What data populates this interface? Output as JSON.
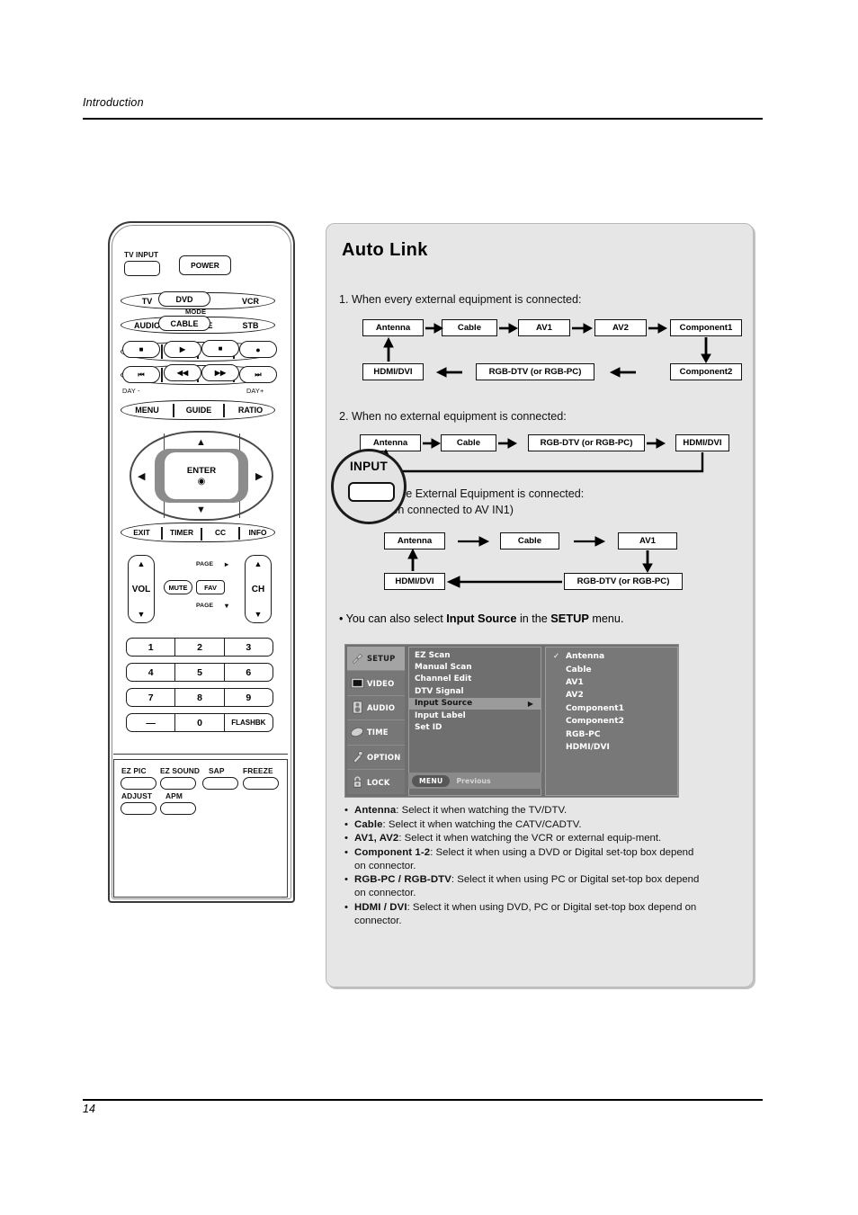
{
  "page": {
    "header": "Introduction",
    "number": "14"
  },
  "remote": {
    "labels": {
      "tv_input": "TV INPUT",
      "power": "POWER",
      "mode": "MODE",
      "day_minus": "DAY -",
      "day_plus": "DAY+",
      "page_up": "PAGE",
      "page_down": "PAGE",
      "vol": "VOL",
      "ch": "CH",
      "enter": "ENTER"
    },
    "mode_row1": [
      "TV",
      "DVD",
      "VCR"
    ],
    "mode_row2": [
      "AUDIO",
      "CABLE",
      "STB"
    ],
    "transport_row1": [
      "stop-icon",
      "play-icon",
      "record-stop-icon",
      "record-icon"
    ],
    "transport_row2": [
      "skip-back-icon",
      "rewind-icon",
      "fast-forward-icon",
      "skip-forward-icon"
    ],
    "menu_row": [
      "MENU",
      "GUIDE",
      "RATIO"
    ],
    "exit_row": [
      "EXIT",
      "TIMER",
      "CC",
      "INFO"
    ],
    "mute": "MUTE",
    "fav": "FAV",
    "keypad": [
      [
        "1",
        "2",
        "3"
      ],
      [
        "4",
        "5",
        "6"
      ],
      [
        "7",
        "8",
        "9"
      ],
      [
        "—",
        "0",
        "FLASHBK"
      ]
    ],
    "bottom_row1": [
      "EZ PIC",
      "EZ SOUND",
      "SAP",
      "FREEZE"
    ],
    "bottom_row2": [
      "ADJUST",
      "APM"
    ],
    "magnifier": {
      "label": "INPUT"
    }
  },
  "panel": {
    "title": "Auto Link",
    "step1": {
      "text": "1. When every external equipment is connected:",
      "top_row": [
        "Antenna",
        "Cable",
        "AV1",
        "AV2",
        "Component1"
      ],
      "bottom_row": [
        "HDMI/DVI",
        "RGB-DTV (or RGB-PC)",
        "Component2"
      ]
    },
    "step2": {
      "text": "2. When no external equipment is connected:",
      "row": [
        "Antenna",
        "Cable",
        "RGB-DTV (or RGB-PC)",
        "HDMI/DVI"
      ]
    },
    "step3": {
      "text_line1": "3. When some External Equipment is connected:",
      "text_line2": "(ex: When connected to AV IN1)",
      "top_row": [
        "Antenna",
        "Cable",
        "AV1"
      ],
      "bottom_row": [
        "HDMI/DVI",
        "RGB-DTV (or RGB-PC)"
      ]
    },
    "note": {
      "prefix": "• You can also select ",
      "bold1": "Input Source",
      "middle": " in the ",
      "bold2": "SETUP",
      "suffix": " menu."
    }
  },
  "osd": {
    "categories": [
      {
        "label": "SETUP",
        "icon": "setup-icon",
        "selected": true
      },
      {
        "label": "VIDEO",
        "icon": "video-icon",
        "selected": false
      },
      {
        "label": "AUDIO",
        "icon": "audio-icon",
        "selected": false
      },
      {
        "label": "TIME",
        "icon": "time-icon",
        "selected": false
      },
      {
        "label": "OPTION",
        "icon": "option-icon",
        "selected": false
      },
      {
        "label": "LOCK",
        "icon": "lock-icon",
        "selected": false
      }
    ],
    "items": [
      {
        "label": "EZ Scan",
        "active": false,
        "chevron": ""
      },
      {
        "label": "Manual Scan",
        "active": false,
        "chevron": ""
      },
      {
        "label": "Channel Edit",
        "active": false,
        "chevron": ""
      },
      {
        "label": "DTV Signal",
        "active": false,
        "chevron": ""
      },
      {
        "label": "Input Source",
        "active": true,
        "chevron": "▶"
      },
      {
        "label": "Input Label",
        "active": false,
        "chevron": ""
      },
      {
        "label": "Set ID",
        "active": false,
        "chevron": ""
      }
    ],
    "menubar": {
      "button": "MENU",
      "text": "Previous"
    },
    "sources": [
      {
        "label": "Antenna",
        "checked": "✓"
      },
      {
        "label": "Cable",
        "checked": ""
      },
      {
        "label": "AV1",
        "checked": ""
      },
      {
        "label": "AV2",
        "checked": ""
      },
      {
        "label": "Component1",
        "checked": ""
      },
      {
        "label": "Component2",
        "checked": ""
      },
      {
        "label": "RGB-PC",
        "checked": ""
      },
      {
        "label": "HDMI/DVI",
        "checked": ""
      }
    ]
  },
  "bullets": [
    {
      "term": "Antenna",
      "rest": ": Select it when watching the TV/DTV."
    },
    {
      "term": "Cable",
      "rest": ": Select it when watching the CATV/CADTV."
    },
    {
      "term": "AV1, AV2",
      "rest": ": Select it when watching the VCR or external equip-ment."
    },
    {
      "term": "Component 1-2",
      "rest": ": Select it when using a DVD or Digital set-top box depend on connector."
    },
    {
      "term": "RGB-PC / RGB-DTV",
      "rest": ": Select it when using PC or Digital set-top box depend on connector."
    },
    {
      "term": "HDMI / DVI",
      "rest": ": Select it when using DVD, PC or Digital set-top box depend on connector."
    }
  ],
  "colors": {
    "panel_bg": "#e6e6e6",
    "osd_bg": "#6f6f6f",
    "osd_highlight": "#9b9b9b"
  }
}
